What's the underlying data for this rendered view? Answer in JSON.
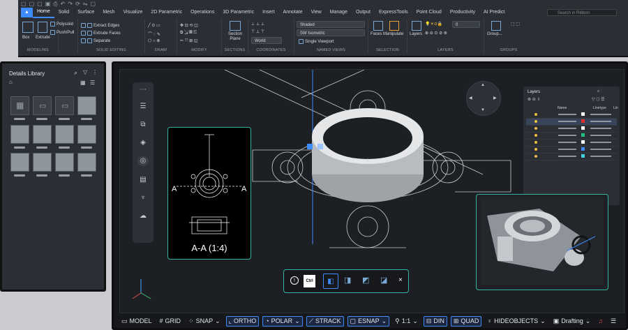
{
  "ribbon": {
    "tabs": [
      "Home",
      "Solid",
      "Surface",
      "Mesh",
      "Visualize",
      "2D Parametric",
      "Operations",
      "3D Parametric",
      "Insert",
      "Annotate",
      "View",
      "Manage",
      "Output",
      "ExpressTools",
      "Point Cloud",
      "Productivity",
      "AI Predict"
    ],
    "search_placeholder": "Search in Ribbon",
    "modeling": {
      "box": "Box",
      "extrude": "Extrude",
      "polysolid": "Polysolid",
      "pushpull": "Push/Pull",
      "label": "MODELING"
    },
    "solid_editing": {
      "extract": "Extract Edges",
      "extrude_faces": "Extrude Faces",
      "separate": "Separate",
      "label": "SOLID EDITING"
    },
    "draw_label": "DRAW",
    "modify_label": "MODIFY",
    "sections": {
      "plane": "Section Plane",
      "label": "SECTIONS"
    },
    "coordinates": {
      "world": "World",
      "label": "COORDINATES"
    },
    "named_views": {
      "style": "Shaded",
      "view": "SW Isometric",
      "viewport": "Single Viewport",
      "label": "NAMED VIEWS"
    },
    "selection": {
      "faces": "Faces",
      "manipulate": "Manipulate",
      "label": "SELECTION"
    },
    "layers": {
      "layers": "Layers",
      "current": "0",
      "label": "LAYERS"
    },
    "groups": {
      "group": "Group...",
      "label": "GROUPS"
    }
  },
  "library": {
    "title": "Details Library"
  },
  "section_view": {
    "caption": "A-A (1:4)",
    "marker_left": "A",
    "marker_right": "A"
  },
  "layers_panel": {
    "title": "Layers",
    "cols": [
      "Name",
      "Linetype",
      "Lin"
    ]
  },
  "floatbar": {
    "ctrl": "Ctrl"
  },
  "status": {
    "model": "MODEL",
    "grid": "GRID",
    "snap": "SNAP",
    "ortho": "ORTHO",
    "polar": "POLAR",
    "strack": "STRACK",
    "esnap": "ESNAP",
    "scale": "1:1",
    "din": "DIN",
    "quad": "QUAD",
    "hideobjects": "HIDEOBJECTS",
    "workspace": "Drafting"
  },
  "colors": {
    "accent": "#3d8bfd",
    "teal": "#36b3a0",
    "panel": "#2b2f35",
    "canvas": "#1c1f23"
  }
}
